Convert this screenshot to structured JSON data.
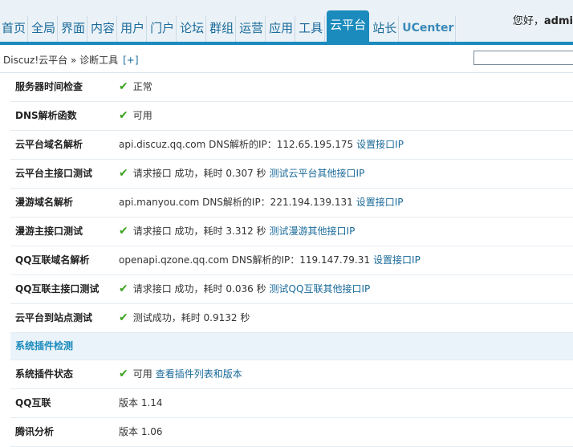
{
  "nav": {
    "items": [
      {
        "label": "首页",
        "active": false
      },
      {
        "label": "全局",
        "active": false
      },
      {
        "label": "界面",
        "active": false
      },
      {
        "label": "内容",
        "active": false
      },
      {
        "label": "用户",
        "active": false
      },
      {
        "label": "门户",
        "active": false
      },
      {
        "label": "论坛",
        "active": false
      },
      {
        "label": "群组",
        "active": false
      },
      {
        "label": "运营",
        "active": false
      },
      {
        "label": "应用",
        "active": false
      },
      {
        "label": "工具",
        "active": false
      },
      {
        "label": "云平台",
        "active": true
      },
      {
        "label": "站长",
        "active": false
      },
      {
        "label": "UCenter",
        "active": false
      }
    ],
    "greeting": "您好，",
    "username": "admi"
  },
  "breadcrumb": {
    "text": "Discuz!云平台 » 诊断工具",
    "plus": "[+]"
  },
  "rows": [
    {
      "label": "服务器时间检查",
      "ok": true,
      "text": "正常",
      "link": ""
    },
    {
      "label": "DNS解析函数",
      "ok": true,
      "text": "可用",
      "link": ""
    },
    {
      "label": "云平台域名解析",
      "ok": false,
      "text": "api.discuz.qq.com DNS解析的IP：112.65.195.175",
      "link": "设置接口IP"
    },
    {
      "label": "云平台主接口测试",
      "ok": true,
      "text": "请求接口 成功，耗时 0.307 秒",
      "link": "测试云平台其他接口IP"
    },
    {
      "label": "漫游域名解析",
      "ok": false,
      "text": "api.manyou.com DNS解析的IP：221.194.139.131",
      "link": "设置接口IP"
    },
    {
      "label": "漫游主接口测试",
      "ok": true,
      "text": "请求接口 成功，耗时 3.312 秒",
      "link": "测试漫游其他接口IP"
    },
    {
      "label": "QQ互联域名解析",
      "ok": false,
      "text": "openapi.qzone.qq.com DNS解析的IP：119.147.79.31",
      "link": "设置接口IP"
    },
    {
      "label": "QQ互联主接口测试",
      "ok": true,
      "text": "请求接口 成功，耗时 0.036 秒",
      "link": "测试QQ互联其他接口IP"
    },
    {
      "label": "云平台到站点测试",
      "ok": true,
      "text": "测试成功，耗时 0.9132 秒",
      "link": ""
    }
  ],
  "section": {
    "title": "系统插件检测"
  },
  "plugin_rows": [
    {
      "label": "系统插件状态",
      "ok": true,
      "text": "可用",
      "link": "查看插件列表和版本"
    },
    {
      "label": "QQ互联",
      "ok": false,
      "text": "版本 1.14",
      "link": ""
    },
    {
      "label": "腾讯分析",
      "ok": false,
      "text": "版本 1.06",
      "link": ""
    }
  ],
  "icons": {
    "ok": "check-icon"
  },
  "colors": {
    "accent": "#1b8bbd",
    "ok": "#3aa11d",
    "link": "#1a6a9a"
  }
}
